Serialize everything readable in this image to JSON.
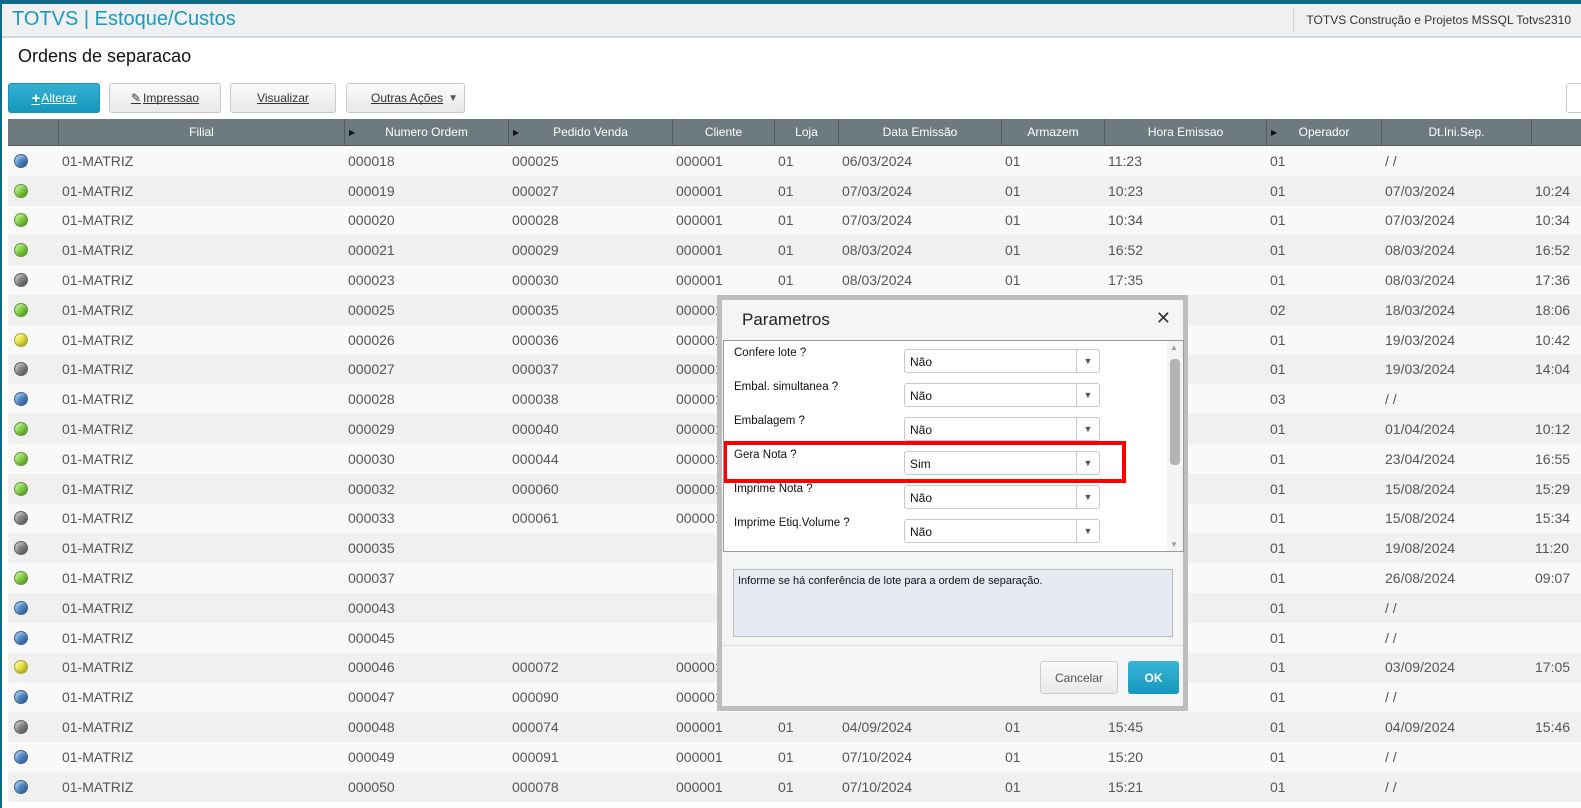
{
  "header": {
    "app_title": "TOTVS | Estoque/Custos",
    "environment": "TOTVS Construção e Projetos MSSQL Totvs2310"
  },
  "page_title": "Ordens de separacao",
  "toolbar": {
    "alterar": "Alterar",
    "impressao": "Impressao",
    "visualizar": "Visualizar",
    "outras_acoes": "Outras Ações"
  },
  "status_colors": {
    "blue": "#4a86c8",
    "green": "#7ed23a",
    "gray": "#808080",
    "yellow": "#e8e43a"
  },
  "columns": [
    {
      "label": "",
      "w": 51
    },
    {
      "label": "Filial",
      "w": 286
    },
    {
      "label": "Numero Ordem",
      "w": 164,
      "arrow": true
    },
    {
      "label": "Pedido Venda",
      "w": 164,
      "arrow": true
    },
    {
      "label": "Cliente",
      "w": 102
    },
    {
      "label": "Loja",
      "w": 64
    },
    {
      "label": "Data Emissão",
      "w": 163
    },
    {
      "label": "Armazem",
      "w": 103
    },
    {
      "label": "Hora Emissao",
      "w": 162
    },
    {
      "label": "Operador",
      "w": 115,
      "arrow": true
    },
    {
      "label": "Dt.Ini.Sep.",
      "w": 150
    },
    {
      "label": "",
      "w": 60
    }
  ],
  "rows": [
    [
      "blue",
      "01-MATRIZ",
      "000018",
      "000025",
      "000001",
      "01",
      "06/03/2024",
      "01",
      "11:23",
      "01",
      " /  /",
      ""
    ],
    [
      "green",
      "01-MATRIZ",
      "000019",
      "000027",
      "000001",
      "01",
      "07/03/2024",
      "01",
      "10:23",
      "01",
      "07/03/2024",
      "10:24"
    ],
    [
      "green",
      "01-MATRIZ",
      "000020",
      "000028",
      "000001",
      "01",
      "07/03/2024",
      "01",
      "10:34",
      "01",
      "07/03/2024",
      "10:34"
    ],
    [
      "green",
      "01-MATRIZ",
      "000021",
      "000029",
      "000001",
      "01",
      "08/03/2024",
      "01",
      "16:52",
      "01",
      "08/03/2024",
      "16:52"
    ],
    [
      "gray",
      "01-MATRIZ",
      "000023",
      "000030",
      "000001",
      "01",
      "08/03/2024",
      "01",
      "17:35",
      "01",
      "08/03/2024",
      "17:36"
    ],
    [
      "green",
      "01-MATRIZ",
      "000025",
      "000035",
      "000001",
      "",
      "",
      "",
      "",
      "02",
      "18/03/2024",
      "18:06"
    ],
    [
      "yellow",
      "01-MATRIZ",
      "000026",
      "000036",
      "000001",
      "",
      "",
      "",
      "",
      "01",
      "19/03/2024",
      "10:42"
    ],
    [
      "gray",
      "01-MATRIZ",
      "000027",
      "000037",
      "000001",
      "",
      "",
      "",
      "",
      "01",
      "19/03/2024",
      "14:04"
    ],
    [
      "blue",
      "01-MATRIZ",
      "000028",
      "000038",
      "000001",
      "",
      "",
      "",
      "",
      "03",
      " /  /",
      ""
    ],
    [
      "green",
      "01-MATRIZ",
      "000029",
      "000040",
      "000001",
      "",
      "",
      "",
      "",
      "01",
      "01/04/2024",
      "10:12"
    ],
    [
      "green",
      "01-MATRIZ",
      "000030",
      "000044",
      "000001",
      "",
      "",
      "",
      "",
      "01",
      "23/04/2024",
      "16:55"
    ],
    [
      "green",
      "01-MATRIZ",
      "000032",
      "000060",
      "000001",
      "",
      "",
      "",
      "",
      "01",
      "15/08/2024",
      "15:29"
    ],
    [
      "gray",
      "01-MATRIZ",
      "000033",
      "000061",
      "000001",
      "",
      "",
      "",
      "",
      "01",
      "15/08/2024",
      "15:34"
    ],
    [
      "gray",
      "01-MATRIZ",
      "000035",
      "",
      "",
      "",
      "",
      "",
      "",
      "01",
      "19/08/2024",
      "11:20"
    ],
    [
      "green",
      "01-MATRIZ",
      "000037",
      "",
      "",
      "",
      "",
      "",
      "",
      "01",
      "26/08/2024",
      "09:07"
    ],
    [
      "blue",
      "01-MATRIZ",
      "000043",
      "",
      "",
      "",
      "",
      "",
      "",
      "01",
      " /  /",
      ""
    ],
    [
      "blue",
      "01-MATRIZ",
      "000045",
      "",
      "",
      "",
      "",
      "",
      "",
      "01",
      " /  /",
      ""
    ],
    [
      "yellow",
      "01-MATRIZ",
      "000046",
      "000072",
      "000001",
      "",
      "",
      "",
      "",
      "01",
      "03/09/2024",
      "17:05"
    ],
    [
      "blue",
      "01-MATRIZ",
      "000047",
      "000090",
      "000001",
      "",
      "",
      "",
      "",
      "01",
      " /  /",
      ""
    ],
    [
      "gray",
      "01-MATRIZ",
      "000048",
      "000074",
      "000001",
      "01",
      "04/09/2024",
      "01",
      "15:45",
      "01",
      "04/09/2024",
      "15:46"
    ],
    [
      "blue",
      "01-MATRIZ",
      "000049",
      "000091",
      "000001",
      "01",
      "07/10/2024",
      "01",
      "15:20",
      "01",
      " /  /",
      ""
    ],
    [
      "blue",
      "01-MATRIZ",
      "000050",
      "000078",
      "000001",
      "01",
      "07/10/2024",
      "01",
      "15:21",
      "01",
      " /  /",
      ""
    ]
  ],
  "dialog": {
    "title": "Parametros",
    "params": [
      {
        "label": "Confere lote ?",
        "value": "Não"
      },
      {
        "label": "Embal. simultanea ?",
        "value": "Não"
      },
      {
        "label": "Embalagem ?",
        "value": "Não"
      },
      {
        "label": "Gera Nota ?",
        "value": "Sim",
        "highlighted": true
      },
      {
        "label": "Imprime Nota ?",
        "value": "Não"
      },
      {
        "label": "Imprime Etiq.Volume ?",
        "value": "Não"
      }
    ],
    "help_text": "Informe se há conferência de lote para a ordem de separação.",
    "cancel": "Cancelar",
    "ok": "OK"
  }
}
